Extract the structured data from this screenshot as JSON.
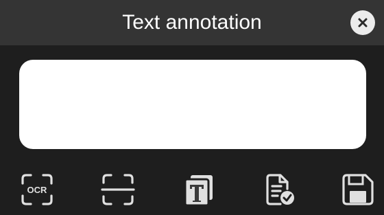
{
  "dialog": {
    "title": "Text annotation",
    "close_icon": "close-icon",
    "text_value": "",
    "colors": {
      "header_bg": "#343434",
      "body_bg": "#1e1e1e",
      "close_bg": "#ececec",
      "icon": "#e0e0e0",
      "accent": "#4a4a4a"
    }
  },
  "toolbar": {
    "ocr_label": "OCR",
    "icons": [
      "ocr-scan-icon",
      "scan-frame-icon",
      "text-format-icon",
      "document-check-icon",
      "save-icon"
    ]
  }
}
